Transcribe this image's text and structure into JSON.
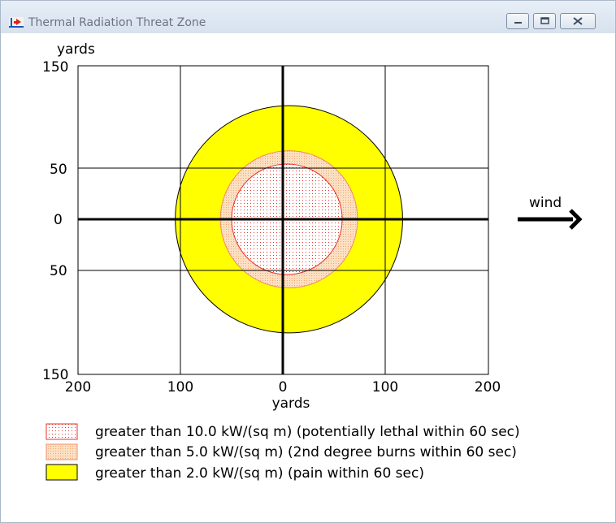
{
  "window": {
    "title": "Thermal Radiation Threat Zone",
    "buttons": [
      "minimize",
      "maximize",
      "close"
    ]
  },
  "plot": {
    "y_axis_title": "yards",
    "x_axis_title": "yards",
    "y_ticks": [
      "150",
      "50",
      "0",
      "50",
      "150"
    ],
    "x_ticks": [
      "200",
      "100",
      "0",
      "100",
      "200"
    ],
    "wind_label": "wind"
  },
  "zones": [
    {
      "label": "greater than 10.0 kW/(sq m) (potentially lethal within 60 sec)",
      "threshold_kw_per_sq_m": 10.0,
      "radius_yards": 54,
      "center_x_yards": 4,
      "fill": "#ffffff",
      "stroke": "#e8302a",
      "pattern": "dots"
    },
    {
      "label": "greater than 5.0 kW/(sq m) (2nd degree burns within 60 sec)",
      "threshold_kw_per_sq_m": 5.0,
      "radius_yards": 67,
      "center_x_yards": 6,
      "fill": "#fde0c2",
      "stroke": "#f08b6a",
      "pattern": "dense-dots"
    },
    {
      "label": "greater than 2.0 kW/(sq m) (pain within 60 sec)",
      "threshold_kw_per_sq_m": 2.0,
      "radius_yards": 111,
      "center_x_yards": 6,
      "fill": "#ffff00",
      "stroke": "#000000",
      "pattern": "solid"
    }
  ],
  "colors": {
    "yellow_zone": "#ffff00",
    "orange_zone": "#fde0c2",
    "red_zone_stroke": "#e8302a"
  }
}
